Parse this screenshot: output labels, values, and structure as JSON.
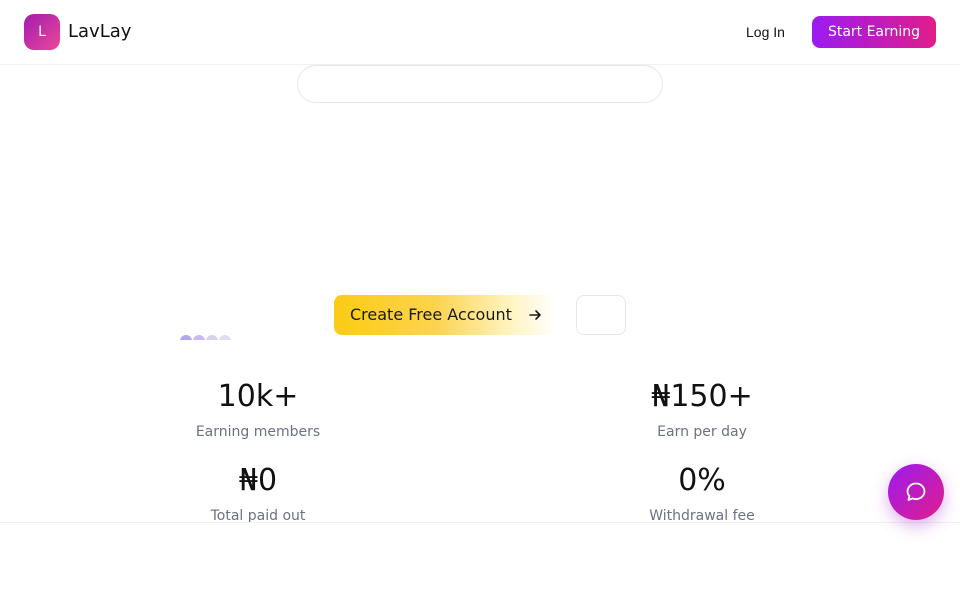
{
  "header": {
    "logo_letter": "L",
    "brand_name": "LavLay",
    "login_label": "Log In",
    "start_label": "Start Earning"
  },
  "cta": {
    "primary_label": "Create Free Account",
    "primary_icon": "arrow-right-icon"
  },
  "stats": [
    {
      "value": "10k+",
      "label": "Earning members"
    },
    {
      "value": "₦150+",
      "label": "Earn per day"
    },
    {
      "value": "₦0",
      "label": "Total paid out"
    },
    {
      "value": "0%",
      "label": "Withdrawal fee"
    }
  ],
  "chat": {
    "icon": "chat-bubble-icon"
  },
  "colors": {
    "brand_gradient_start": "#9b1cf0",
    "brand_gradient_end": "#e11d8b",
    "cta_yellow": "#facc15",
    "muted_text": "#6b7280",
    "avatars": [
      "#b4a6f0",
      "#c9b8f5",
      "#d3d3ea",
      "#e2ddf3"
    ]
  }
}
